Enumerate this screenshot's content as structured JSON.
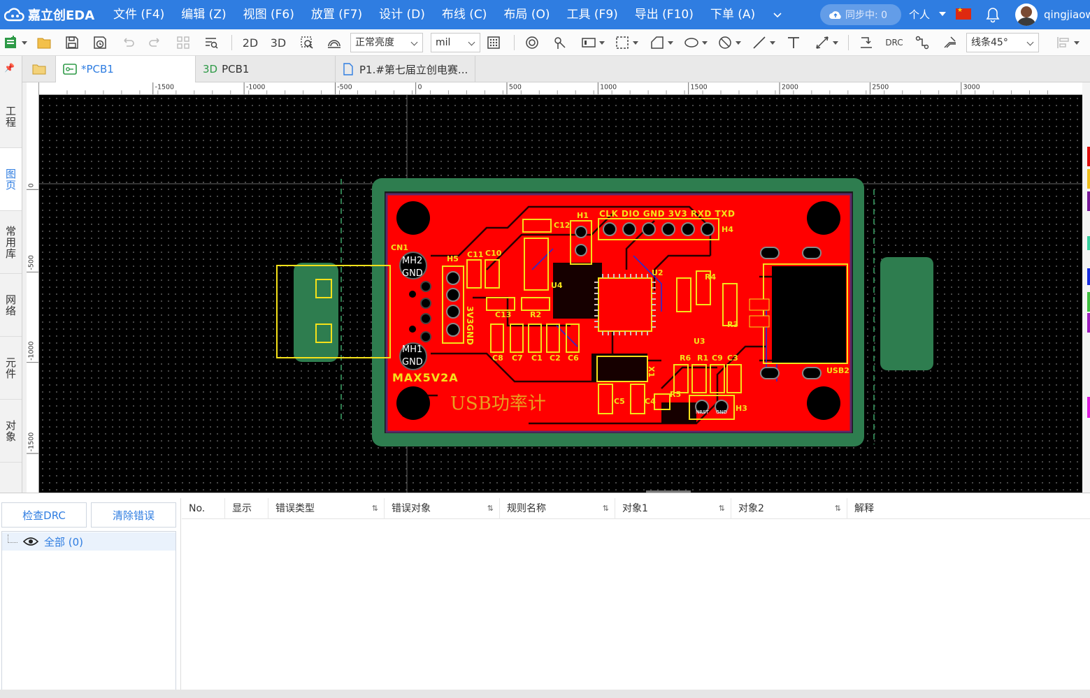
{
  "app": {
    "logo_text": "嘉立创EDA",
    "menu": [
      "文件 (F4)",
      "编辑 (Z)",
      "视图 (F6)",
      "放置 (F7)",
      "设计 (D)",
      "布线 (C)",
      "布局 (O)",
      "工具 (F9)",
      "导出 (F10)",
      "下单 (A)"
    ],
    "sync_label": "同步中: 0",
    "personal_label": "个人",
    "username": "qingjiaowo",
    "colors": {
      "brand": "#2f7de1",
      "board_red": "#ff0000",
      "silk_yellow": "#f5e11a",
      "outline_green": "#2e7d4f"
    }
  },
  "toolbar": {
    "view_2d": "2D",
    "view_3d": "3D",
    "brightness": "正常亮度",
    "unit": "mil",
    "drc_label": "DRC",
    "line_angle": "线条45°"
  },
  "left_tabs": [
    "工程",
    "图页",
    "常用库",
    "网络",
    "元件",
    "对象"
  ],
  "doc_tabs": [
    {
      "label": "*PCB1",
      "icon": "pcb-icon"
    },
    {
      "label": "PCB1",
      "prefix": "3D"
    },
    {
      "label": "P1.#第七届立创电赛...",
      "icon": "document-icon"
    }
  ],
  "ruler": {
    "top_ticks": [
      "-1500",
      "-1000",
      "-500",
      "0",
      "500",
      "1000",
      "1500",
      "2000",
      "2500",
      "3000"
    ],
    "left_ticks": [
      "0",
      "-500",
      "-1000",
      "-1500"
    ]
  },
  "pcb": {
    "board_label": "MAX5V2A",
    "title_text": "USB功率计",
    "header_pins": "CLK DIO GND 3V3 RXD TXD",
    "designators": [
      "CN1",
      "H5",
      "H1",
      "H4",
      "H3",
      "U2",
      "U3",
      "U4",
      "C12",
      "C11",
      "C10",
      "C13",
      "R2",
      "R3",
      "R4",
      "R6",
      "R1",
      "C9",
      "C3",
      "C8",
      "C7",
      "C1",
      "C2",
      "C6",
      "C5",
      "C4",
      "R5",
      "USB2",
      "X1"
    ],
    "mh_labels": [
      "MH2",
      "GND",
      "MH1",
      "GND"
    ],
    "h5_label": "3V3GND",
    "h3_pins": [
      "NRST",
      "GND"
    ]
  },
  "drc": {
    "check_button": "检查DRC",
    "clear_button": "清除错误",
    "tree_all": "全部 (0)",
    "columns": [
      "No.",
      "显示",
      "错误类型",
      "错误对象",
      "规则名称",
      "对象1",
      "对象2",
      "解释"
    ]
  }
}
